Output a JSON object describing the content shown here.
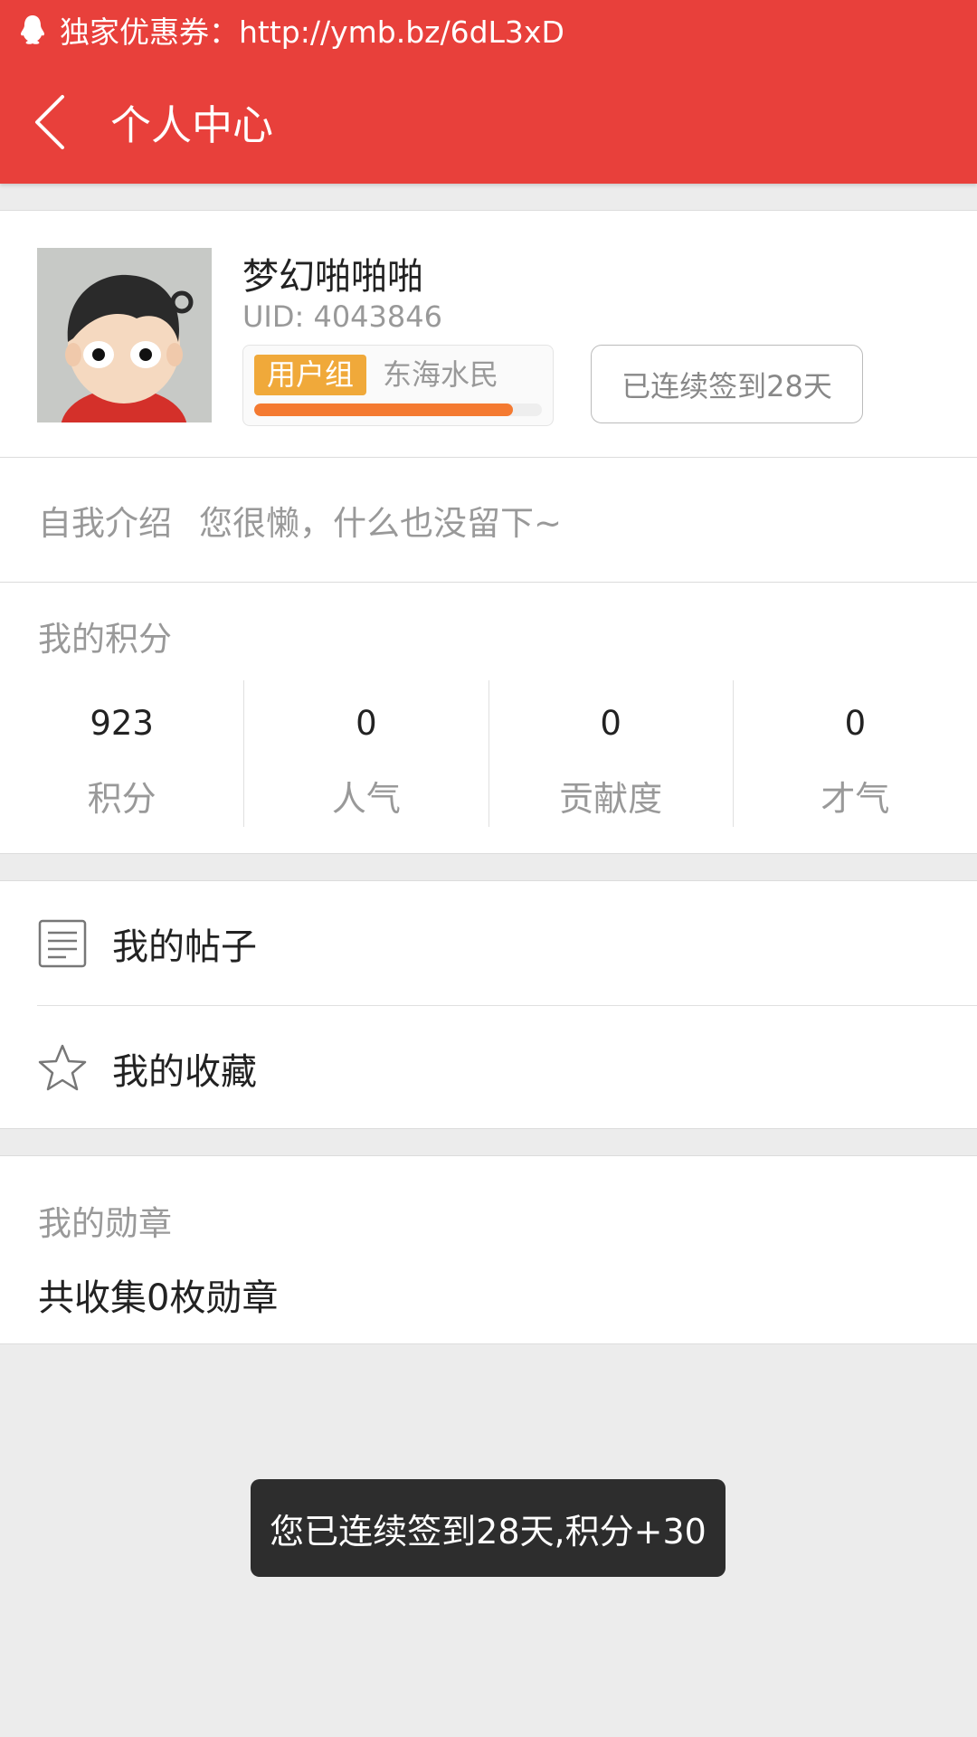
{
  "status_bar": {
    "notification_text": "独家优惠券：http://ymb.bz/6dL3xD",
    "icon": "qq-penguin-icon"
  },
  "appbar": {
    "title": "个人中心",
    "back_icon": "chevron-left-icon"
  },
  "profile": {
    "username": "梦幻啪啪啪",
    "uid": "UID: 4043846",
    "group_badge": "用户组",
    "group_name": "东海水民",
    "level_progress": 0.9,
    "checkin_button": "已连续签到28天"
  },
  "intro": {
    "label": "自我介绍",
    "text": "您很懒，什么也没留下~"
  },
  "points": {
    "title": "我的积分",
    "stats": [
      {
        "value": "923",
        "label": "积分"
      },
      {
        "value": "0",
        "label": "人气"
      },
      {
        "value": "0",
        "label": "贡献度"
      },
      {
        "value": "0",
        "label": "才气"
      }
    ]
  },
  "menu": {
    "items": [
      {
        "label": "我的帖子",
        "icon": "document-icon"
      },
      {
        "label": "我的收藏",
        "icon": "star-icon"
      }
    ]
  },
  "medals": {
    "title": "我的勋章",
    "summary": "共收集0枚勋章"
  },
  "toast": {
    "text": "您已连续签到28天,积分+30"
  },
  "colors": {
    "header": "#e8403b",
    "badge": "#f0a93a",
    "progress": "#f47a31"
  }
}
